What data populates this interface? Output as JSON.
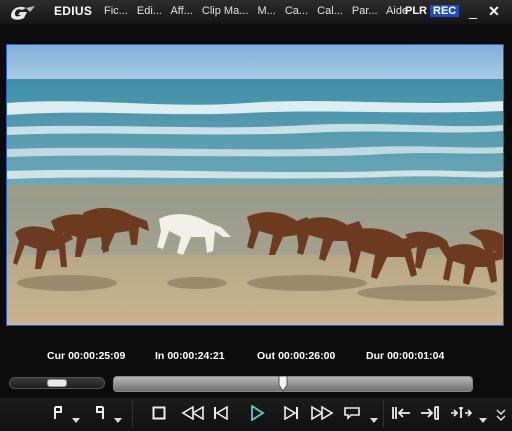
{
  "app": {
    "name": "EDIUS"
  },
  "menu": {
    "items": [
      "Fic...",
      "Edi...",
      "Aff...",
      "Clip Ma...",
      "M...",
      "Ca...",
      "Cal...",
      "Par...",
      "Aide"
    ]
  },
  "modes": {
    "player": "PLR",
    "recorder": "REC",
    "active": "REC"
  },
  "window_buttons": {
    "minimize": "_",
    "close": "✕"
  },
  "timecodes": {
    "cur": {
      "label": "Cur",
      "value": "00:00:25:09"
    },
    "in": {
      "label": "In",
      "value": "00:00:24:21"
    },
    "out": {
      "label": "Out",
      "value": "00:00:26:00"
    },
    "dur": {
      "label": "Dur",
      "value": "00:00:01:04"
    }
  },
  "shuttle": {
    "position": 0.5
  },
  "scrubber": {
    "position": 0.47
  },
  "icons": {
    "logo": "edius-logo-icon",
    "mark_in": "mark-in-icon",
    "mark_out": "mark-out-icon",
    "stop": "stop-icon",
    "rewind": "rewind-icon",
    "step_back": "step-back-icon",
    "play": "play-icon",
    "step_forward": "step-forward-icon",
    "fast_forward": "fast-forward-icon",
    "loop": "loop-icon",
    "insert": "insert-to-timeline-icon",
    "overwrite": "overwrite-to-timeline-icon",
    "set_in_out": "set-in-out-icon"
  },
  "colors": {
    "accent": "#2d5bd0",
    "rec": "#1f4fb4",
    "play": "#5fc9c4"
  }
}
